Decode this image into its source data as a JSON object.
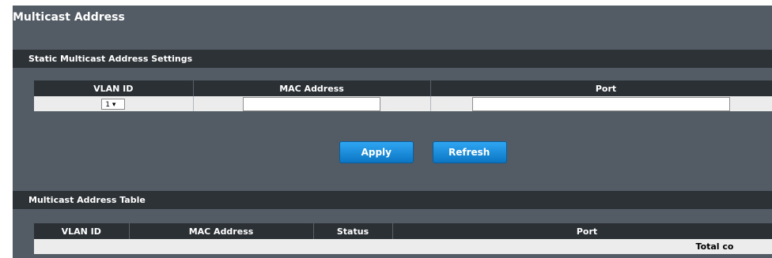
{
  "page": {
    "title": "Multicast Address"
  },
  "static_settings": {
    "title": "Static Multicast Address Settings",
    "columns": [
      "VLAN ID",
      "MAC Address",
      "Port"
    ],
    "vlan_select_value": "1 ▾",
    "mac_value": "",
    "port_value": ""
  },
  "buttons": {
    "apply": "Apply",
    "refresh": "Refresh"
  },
  "address_table": {
    "title": "Multicast Address Table",
    "columns": [
      "VLAN ID",
      "MAC Address",
      "Status",
      "Port"
    ],
    "total_label": "Total co"
  }
}
